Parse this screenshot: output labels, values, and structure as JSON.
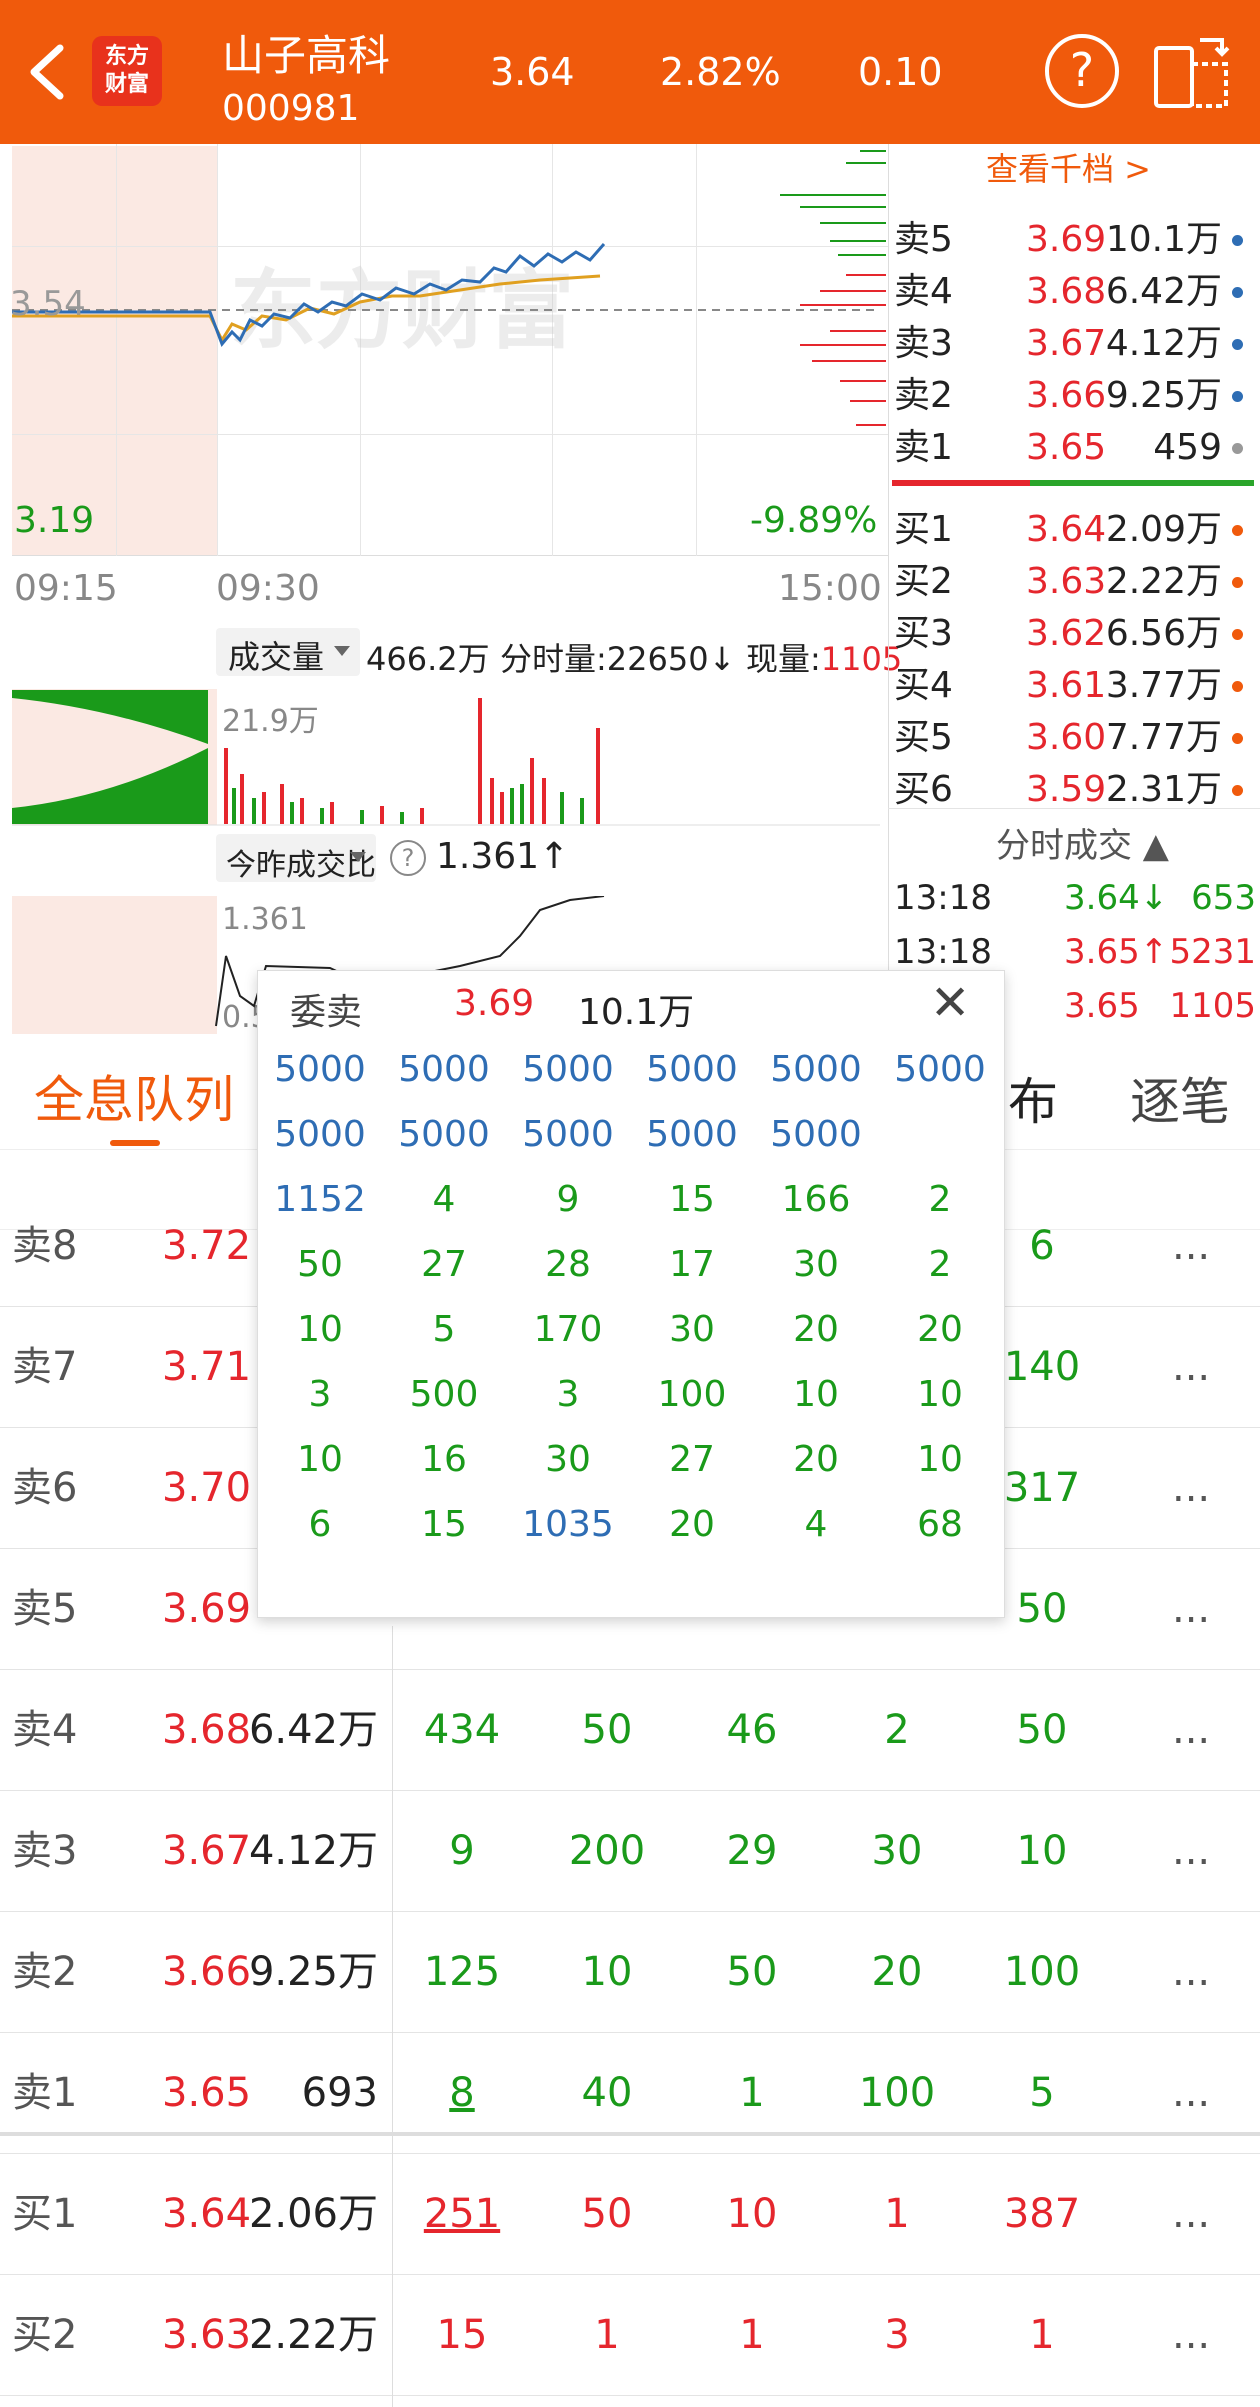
{
  "header": {
    "back": "back",
    "logo": [
      "东方",
      "财富"
    ],
    "name": "山子高科",
    "code": "000981",
    "price": "3.64",
    "pct": "2.82%",
    "change": "0.10",
    "help": "?",
    "orientation_icon": "rotate-screen"
  },
  "chart": {
    "ref_price": "3.54",
    "low_price": "3.19",
    "low_pct": "-9.89%",
    "times": [
      "09:15",
      "09:30",
      "15:00"
    ],
    "watermark": "东方财富",
    "view_levels": "查看千档 >"
  },
  "volume": {
    "dropdown": "成交量",
    "total": "466.2万",
    "tick_label": "分时量:22650↓",
    "now_label": "现量:",
    "now_value": "1105",
    "max": "21.9万"
  },
  "ratio": {
    "dropdown": "今昨成交比",
    "value": "1.361↑",
    "axis_max": "1.361",
    "axis_min": "0.5"
  },
  "orderbook": {
    "asks": [
      {
        "label": "卖5",
        "price": "3.69",
        "vol": "10.1万"
      },
      {
        "label": "卖4",
        "price": "3.68",
        "vol": "6.42万"
      },
      {
        "label": "卖3",
        "price": "3.67",
        "vol": "4.12万"
      },
      {
        "label": "卖2",
        "price": "3.66",
        "vol": "9.25万"
      },
      {
        "label": "卖1",
        "price": "3.65",
        "vol": "459"
      }
    ],
    "bids": [
      {
        "label": "买1",
        "price": "3.64",
        "vol": "2.09万"
      },
      {
        "label": "买2",
        "price": "3.63",
        "vol": "2.22万"
      },
      {
        "label": "买3",
        "price": "3.62",
        "vol": "6.56万"
      },
      {
        "label": "买4",
        "price": "3.61",
        "vol": "3.77万"
      },
      {
        "label": "买5",
        "price": "3.60",
        "vol": "7.77万"
      },
      {
        "label": "买6",
        "price": "3.59",
        "vol": "2.31万"
      }
    ]
  },
  "ticks": {
    "title": "分时成交",
    "rows": [
      {
        "time": "13:18",
        "price": "3.64↓",
        "vol": "653"
      },
      {
        "time": "13:18",
        "price": "3.65↑",
        "vol": "5231"
      },
      {
        "time": "",
        "price": "3.65",
        "vol": "1105"
      }
    ]
  },
  "tabs": {
    "t1": "全息队列",
    "t2": "布",
    "t3": "逐笔"
  },
  "queue": {
    "rows": [
      {
        "label": "卖8",
        "price": "3.72",
        "vol": "",
        "c": [
          "",
          "",
          "",
          "",
          "6"
        ],
        "more": "..."
      },
      {
        "label": "卖7",
        "price": "3.71",
        "vol": "",
        "c": [
          "",
          "",
          "",
          "",
          "140"
        ],
        "more": "..."
      },
      {
        "label": "卖6",
        "price": "3.70",
        "vol": "",
        "c": [
          "",
          "",
          "",
          "",
          "317"
        ],
        "more": "..."
      },
      {
        "label": "卖5",
        "price": "3.69",
        "vol": "",
        "c": [
          "",
          "",
          "",
          "",
          "50"
        ],
        "more": "..."
      },
      {
        "label": "卖4",
        "price": "3.68",
        "vol": "6.42万",
        "c": [
          "434",
          "50",
          "46",
          "2",
          "50"
        ],
        "more": "..."
      },
      {
        "label": "卖3",
        "price": "3.67",
        "vol": "4.12万",
        "c": [
          "9",
          "200",
          "29",
          "30",
          "10"
        ],
        "more": "..."
      },
      {
        "label": "卖2",
        "price": "3.66",
        "vol": "9.25万",
        "c": [
          "125",
          "10",
          "50",
          "20",
          "100"
        ],
        "more": "..."
      },
      {
        "label": "卖1",
        "price": "3.65",
        "vol": "693",
        "c": [
          "8",
          "40",
          "1",
          "100",
          "5"
        ],
        "more": "..."
      },
      {
        "label": "买1",
        "price": "3.64",
        "vol": "2.06万",
        "c": [
          "251",
          "50",
          "10",
          "1",
          "387"
        ],
        "more": "..."
      },
      {
        "label": "买2",
        "price": "3.63",
        "vol": "2.22万",
        "c": [
          "15",
          "1",
          "1",
          "3",
          "1"
        ],
        "more": "..."
      }
    ]
  },
  "popup": {
    "title": "委卖",
    "price": "3.69",
    "vol": "10.1万",
    "close": "✕",
    "grid": [
      [
        "5000",
        "5000",
        "5000",
        "5000",
        "5000",
        "5000"
      ],
      [
        "5000",
        "5000",
        "5000",
        "5000",
        "5000",
        ""
      ],
      [
        "1152",
        "4",
        "9",
        "15",
        "166",
        "2"
      ],
      [
        "50",
        "27",
        "28",
        "17",
        "30",
        "2"
      ],
      [
        "10",
        "5",
        "170",
        "30",
        "20",
        "20"
      ],
      [
        "3",
        "500",
        "3",
        "100",
        "10",
        "10"
      ],
      [
        "10",
        "16",
        "30",
        "27",
        "20",
        "10"
      ],
      [
        "6",
        "15",
        "1035",
        "20",
        "4",
        "68"
      ]
    ]
  },
  "colors": {
    "brand": "#f05a0c",
    "up": "#e5262d",
    "down": "#1a9a1a",
    "blue": "#2e6db4",
    "avg": "#e0a020"
  }
}
